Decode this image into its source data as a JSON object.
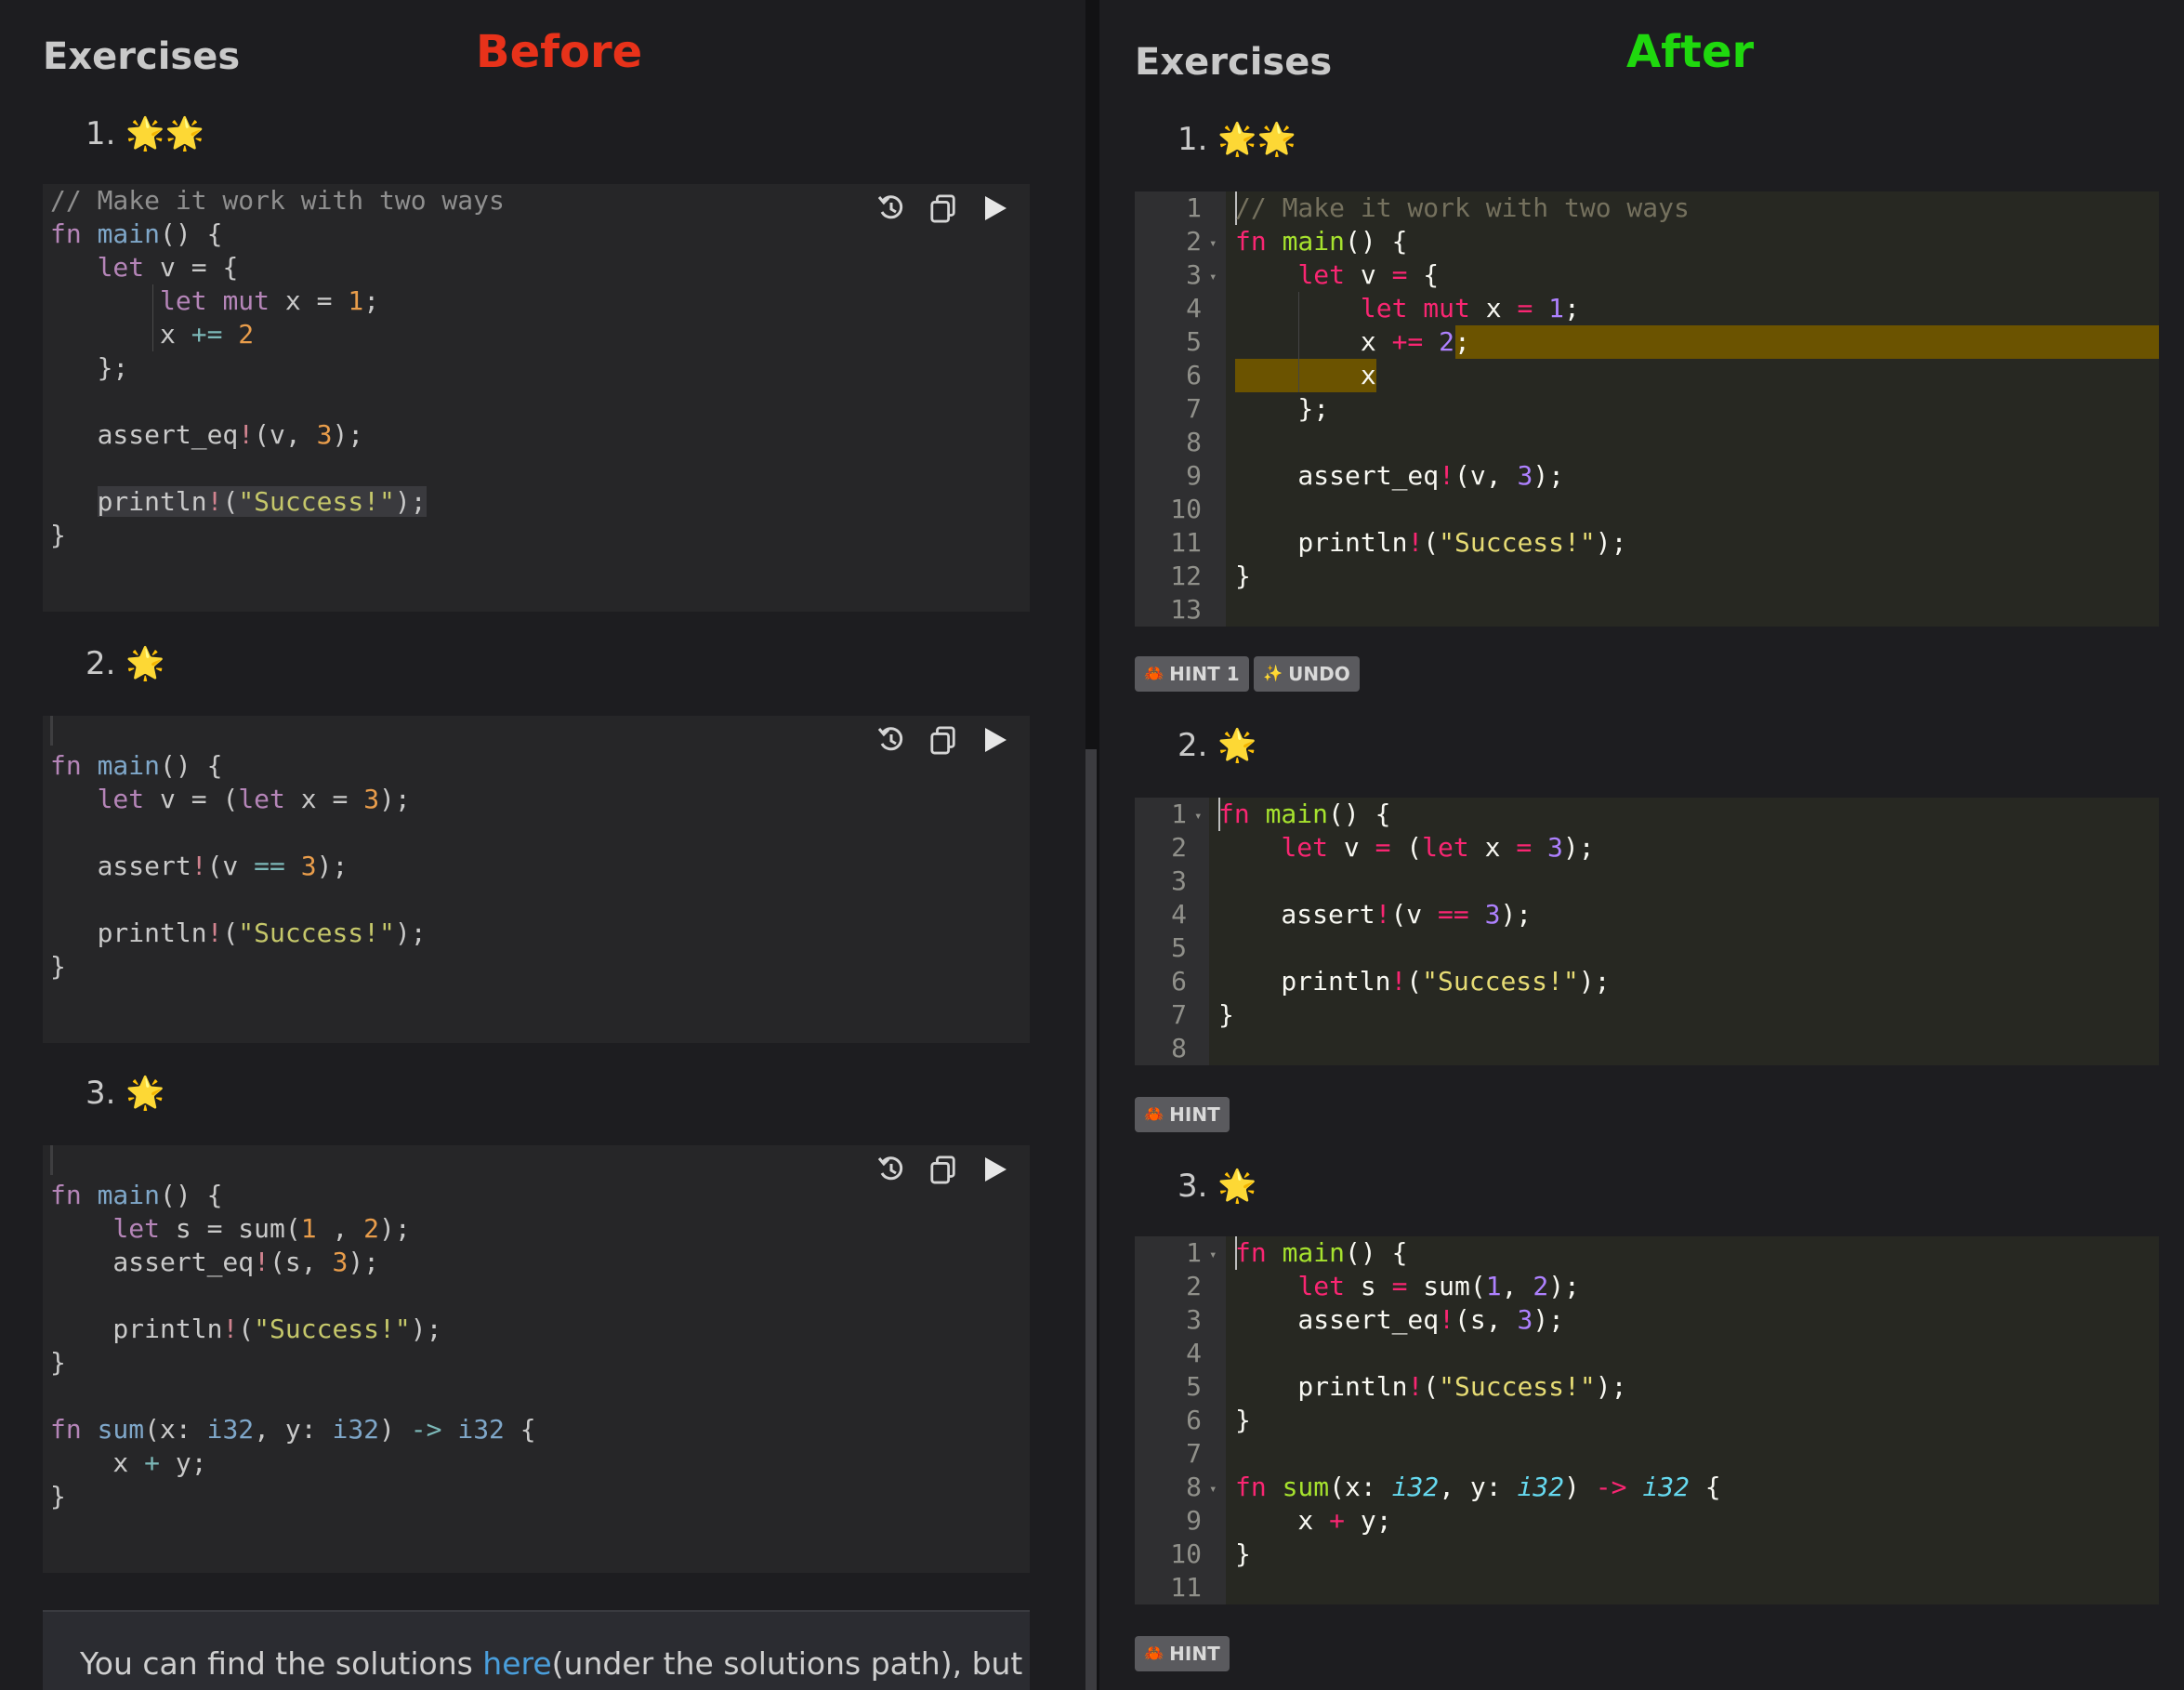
{
  "left": {
    "heading": "Exercises",
    "state_label": "Before",
    "exercises": [
      {
        "number": "1.",
        "stars": "🌟🌟",
        "code": [
          "// Make it work with two ways",
          "fn main() {",
          "   let v = {",
          "       let mut x = 1;",
          "       x += 2",
          "   };",
          "",
          "   assert_eq!(v, 3);",
          "",
          "   println!(\"Success!\");",
          "}"
        ]
      },
      {
        "number": "2.",
        "stars": "🌟",
        "code": [
          "",
          "fn main() {",
          "   let v = (let x = 3);",
          "",
          "   assert!(v == 3);",
          "",
          "   println!(\"Success!\");",
          "}"
        ]
      },
      {
        "number": "3.",
        "stars": "🌟",
        "code": [
          "",
          "fn main() {",
          "    let s = sum(1 , 2);",
          "    assert_eq!(s, 3);",
          "",
          "    println!(\"Success!\");",
          "}",
          "",
          "fn sum(x: i32, y: i32) -> i32 {",
          "    x + y;",
          "}"
        ]
      }
    ],
    "notice": {
      "before": "You can find the solutions ",
      "link": "here",
      "after": "(under the solutions path), but"
    },
    "toolbar": [
      "undo-icon",
      "copy-icon",
      "play-icon"
    ]
  },
  "right": {
    "heading": "Exercises",
    "state_label": "After",
    "exercises": [
      {
        "number": "1.",
        "stars": "🌟🌟",
        "line_numbers": [
          "1",
          "2",
          "3",
          "4",
          "5",
          "6",
          "7",
          "8",
          "9",
          "10",
          "11",
          "12",
          "13"
        ],
        "code": [
          "// Make it work with two ways",
          "fn main() {",
          "    let v = {",
          "        let mut x = 1;",
          "        x += 2;",
          "        x",
          "    };",
          "",
          "    assert_eq!(v, 3);",
          "",
          "    println!(\"Success!\");",
          "}",
          ""
        ],
        "buttons": [
          {
            "icon": "🦀",
            "label": "HINT 1"
          },
          {
            "icon": "✨",
            "label": "UNDO"
          }
        ]
      },
      {
        "number": "2.",
        "stars": "🌟",
        "line_numbers": [
          "1",
          "2",
          "3",
          "4",
          "5",
          "6",
          "7",
          "8"
        ],
        "code": [
          "fn main() {",
          "    let v = (let x = 3);",
          "",
          "    assert!(v == 3);",
          "",
          "    println!(\"Success!\");",
          "}",
          ""
        ],
        "buttons": [
          {
            "icon": "🦀",
            "label": "HINT"
          }
        ]
      },
      {
        "number": "3.",
        "stars": "🌟",
        "line_numbers": [
          "1",
          "2",
          "3",
          "4",
          "5",
          "6",
          "7",
          "8",
          "9",
          "10",
          "11"
        ],
        "code": [
          "fn main() {",
          "    let s = sum(1, 2);",
          "    assert_eq!(s, 3);",
          "",
          "    println!(\"Success!\");",
          "}",
          "",
          "fn sum(x: i32, y: i32) -> i32 {",
          "    x + y;",
          "}",
          ""
        ],
        "buttons": [
          {
            "icon": "🦀",
            "label": "HINT"
          }
        ]
      }
    ]
  },
  "colors": {
    "before_label": "#e8321a",
    "after_label": "#1fd80e",
    "link": "#4a9fdc",
    "highlight": "#6b5300"
  }
}
